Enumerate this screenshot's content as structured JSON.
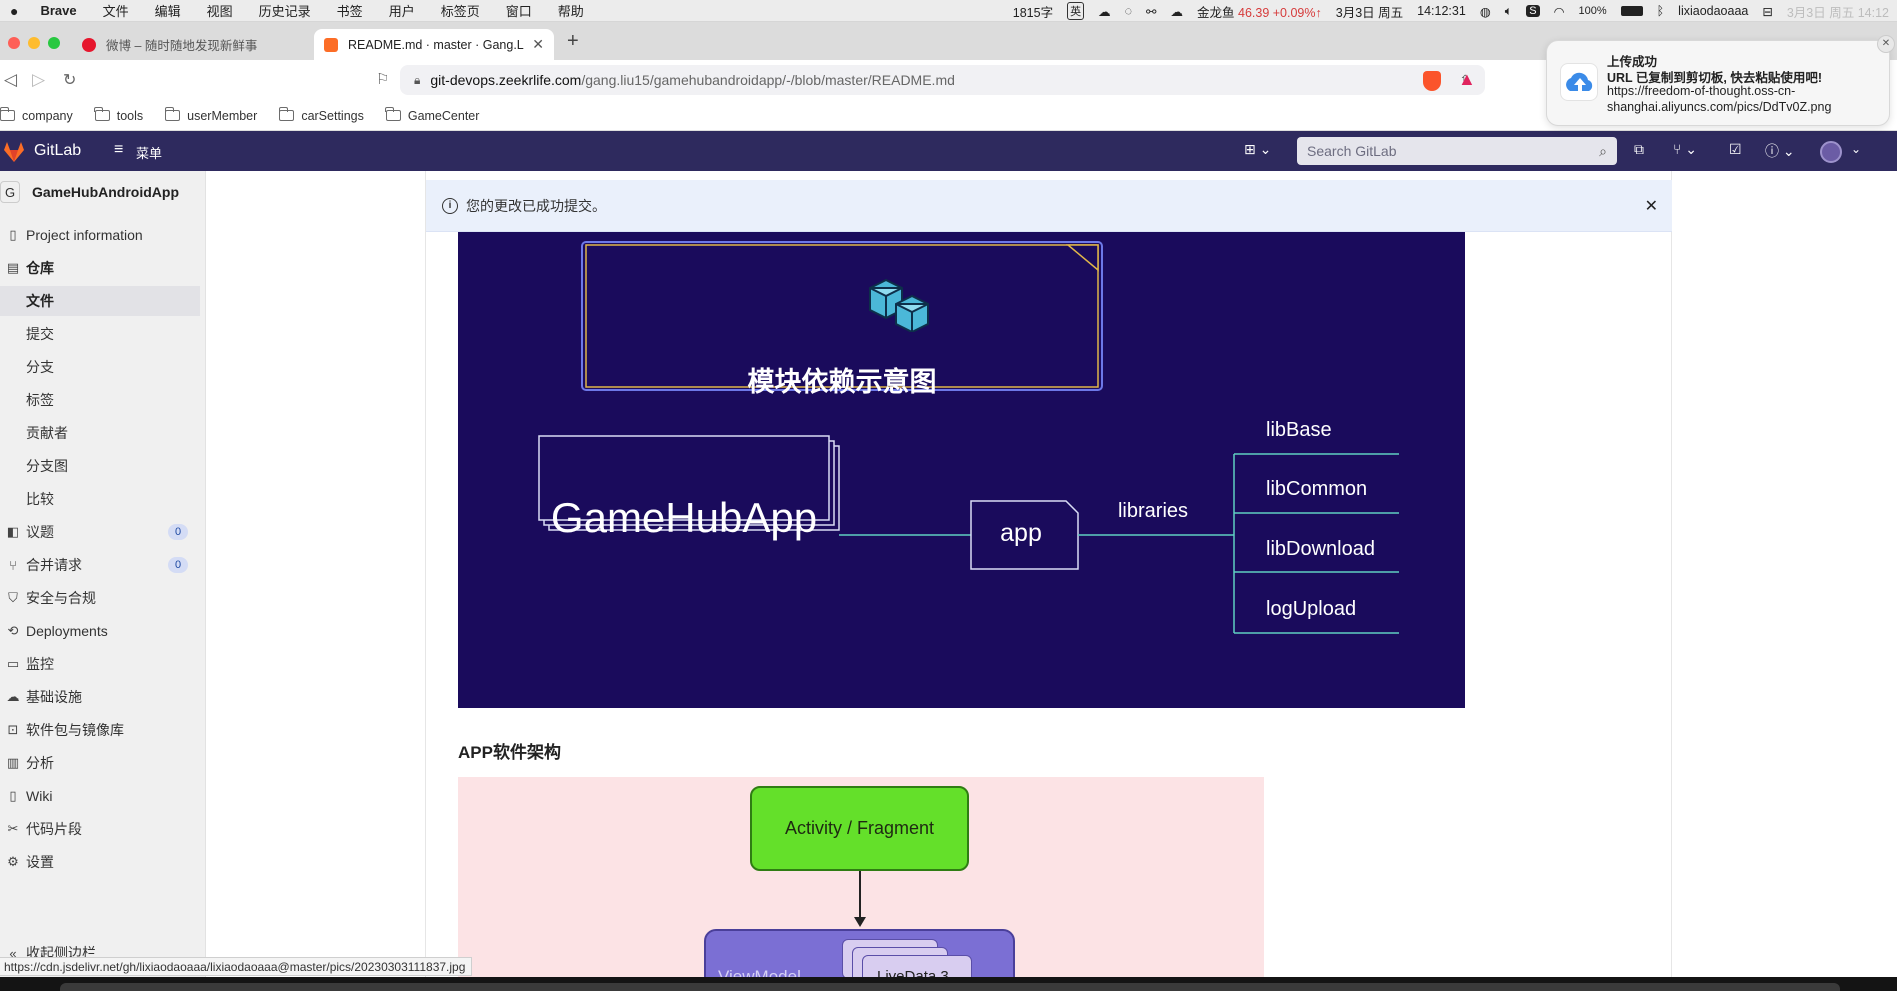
{
  "menubar": {
    "app": "Brave",
    "items": [
      "文件",
      "编辑",
      "视图",
      "历史记录",
      "书签",
      "用户",
      "标签页",
      "窗口",
      "帮助"
    ],
    "word_count": "1815字",
    "input_method": "英",
    "stock_name": "金龙鱼",
    "stock_value": "46.39 +0.09%↑",
    "date": "3月3日 周五",
    "time": "14:12:31",
    "battery": "100%",
    "user": "lixiaodaoaaa",
    "ghost_clock": "3月3日 周五 14:12"
  },
  "tabs": [
    {
      "title": "微博 – 随时随地发现新鲜事",
      "active": false
    },
    {
      "title": "README.md · master · Gang.L",
      "active": true
    }
  ],
  "new_tab": "+",
  "url": {
    "host": "git-devops.zeekrlife.com",
    "path": "/gang.liu15/gamehubandroidapp/-/blob/master/README.md"
  },
  "bookmarks": [
    "company",
    "tools",
    "userMember",
    "carSettings",
    "GameCenter"
  ],
  "gitlab": {
    "brand": "GitLab",
    "menu_label": "菜单",
    "search_placeholder": "Search GitLab"
  },
  "sidebar": {
    "project_avatar": "G",
    "project_name": "GameHubAndroidApp",
    "items": [
      {
        "label": "Project information",
        "icon": "info-icon",
        "sub": false
      },
      {
        "label": "仓库",
        "icon": "repo-icon",
        "sub": false,
        "active_parent": true
      },
      {
        "label": "文件",
        "sub": true,
        "active": true
      },
      {
        "label": "提交",
        "sub": true
      },
      {
        "label": "分支",
        "sub": true
      },
      {
        "label": "标签",
        "sub": true
      },
      {
        "label": "贡献者",
        "sub": true
      },
      {
        "label": "分支图",
        "sub": true
      },
      {
        "label": "比较",
        "sub": true
      },
      {
        "label": "议题",
        "icon": "issues-icon",
        "sub": false,
        "badge": "0"
      },
      {
        "label": "合并请求",
        "icon": "merge-request-icon",
        "sub": false,
        "badge": "0"
      },
      {
        "label": "安全与合规",
        "icon": "shield-icon",
        "sub": false
      },
      {
        "label": "Deployments",
        "icon": "deploy-icon",
        "sub": false
      },
      {
        "label": "监控",
        "icon": "monitor-icon",
        "sub": false
      },
      {
        "label": "基础设施",
        "icon": "cloud-icon",
        "sub": false
      },
      {
        "label": "软件包与镜像库",
        "icon": "package-icon",
        "sub": false
      },
      {
        "label": "分析",
        "icon": "chart-icon",
        "sub": false
      },
      {
        "label": "Wiki",
        "icon": "book-icon",
        "sub": false
      },
      {
        "label": "代码片段",
        "icon": "snippet-icon",
        "sub": false
      },
      {
        "label": "设置",
        "icon": "gear-icon",
        "sub": false
      }
    ],
    "collapse": "收起侧边栏"
  },
  "flash": {
    "message": "您的更改已成功提交。"
  },
  "diagram1": {
    "title": "模块依赖示意图",
    "app_node": "GameHubApp",
    "module_node": "app",
    "edge_label": "libraries",
    "libs": [
      "libBase",
      "libCommon",
      "libDownload",
      "logUpload"
    ]
  },
  "section_title": "APP软件架构",
  "diagram2": {
    "top_node": "Activity / Fragment",
    "viewmodel_label": "ViewModel",
    "livedata_label": "LiveData 3"
  },
  "status_url": "https://cdn.jsdelivr.net/gh/lixiaodaoaaa/lixiaodaoaaa@master/pics/20230303111837.jpg",
  "notification": {
    "title": "上传成功",
    "line1": "URL 已复制到剪切板, 快去粘贴使用吧!",
    "line2": "https://freedom-of-thought.oss-cn-shanghai.aliyuncs.com/pics/DdTv0Z.png"
  },
  "colors": {
    "gitlab_header": "#2e2a5e",
    "diagram_bg": "#1a0b5c",
    "diagram2_bg": "#fce3e5",
    "activity_green": "#64e02a",
    "viewmodel_purple": "#7b6fd4",
    "flash_bg": "#eaf0fb"
  }
}
